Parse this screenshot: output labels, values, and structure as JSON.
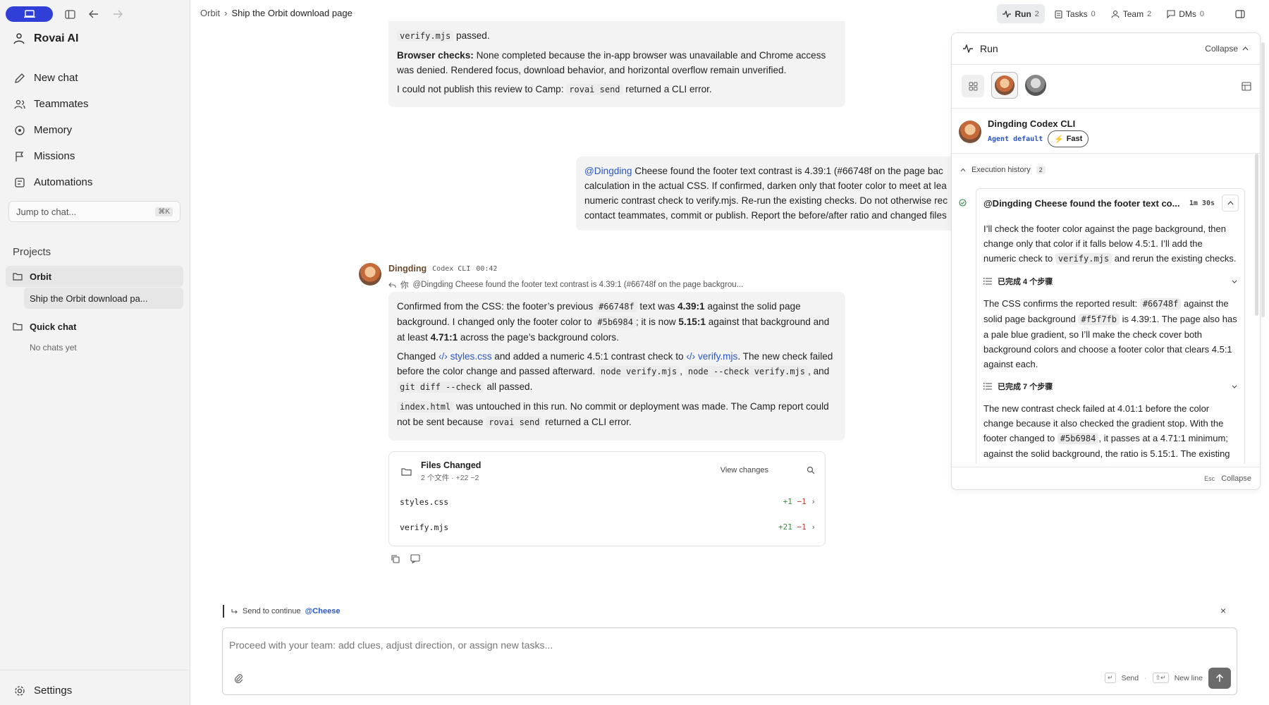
{
  "sidebar": {
    "brand": "Rovai AI",
    "nav": [
      {
        "label": "New chat",
        "icon": "edit-icon"
      },
      {
        "label": "Teammates",
        "icon": "users-icon"
      },
      {
        "label": "Memory",
        "icon": "memory-icon"
      },
      {
        "label": "Missions",
        "icon": "flag-icon"
      },
      {
        "label": "Automations",
        "icon": "automation-icon"
      }
    ],
    "jump": {
      "label": "Jump to chat...",
      "shortcut": "⌘K"
    },
    "projects_heading": "Projects",
    "projects": [
      {
        "name": "Orbit",
        "chat": "Ship the Orbit download pa..."
      },
      {
        "name": "Quick chat",
        "chat": "No chats yet"
      }
    ],
    "settings": "Settings"
  },
  "header": {
    "crumb_project": "Orbit",
    "crumb_sep": "›",
    "crumb_page": "Ship the Orbit download page",
    "buttons": [
      {
        "label": "Run",
        "count": "2"
      },
      {
        "label": "Tasks",
        "count": "0"
      },
      {
        "label": "Team",
        "count": "2"
      },
      {
        "label": "DMs",
        "count": "0"
      }
    ]
  },
  "chat": {
    "top_bubble": {
      "line1_code": "verify.mjs",
      "line1_rest": " passed.",
      "browser_bold": "Browser checks:",
      "browser_text": " None completed because the in-app browser was unavailable and Chrome access was denied. Rendered focus, download behavior, and horizontal overflow remain unverified.",
      "camp_pre": "I could not publish this review to Camp: ",
      "camp_code": "rovai send",
      "camp_post": " returned a CLI error."
    },
    "user_bubble": {
      "mention": "@Dingding",
      "lines": [
        " Cheese found the footer text contrast is 4.39:1 (#66748f on the page bac",
        "calculation in the actual CSS. If confirmed, darken only that footer color to meet at lea",
        "numeric contrast check to verify.mjs. Re-run the existing checks. Do not otherwise rec",
        "contact teammates, commit or publish. Report the before/after ratio and changed files"
      ]
    },
    "reply": {
      "author": "Dingding",
      "tag": "Codex CLI",
      "time": "00:42",
      "quote_you": "你",
      "quote": "@Dingding Cheese found the footer text contrast is 4.39:1 (#66748f on the page backgrou...",
      "p1": [
        "Confirmed from the CSS: the footer’s previous ",
        "#66748f",
        " text was ",
        "4.39:1",
        " against the solid page background. I changed only the footer color to ",
        "#5b6984",
        "; it is now ",
        "5.15:1",
        " against that background and at least ",
        "4.71:1",
        " across the page’s background colors."
      ],
      "p2": [
        "Changed ",
        "styles.css",
        " and added a numeric 4.5:1 contrast check to ",
        "verify.mjs",
        ". The new check failed before the color change and passed afterward. ",
        "node verify.mjs",
        ", ",
        "node --check verify.mjs",
        ", and ",
        "git diff --check",
        " all passed."
      ],
      "p3": [
        "index.html",
        " was untouched in this run. No commit or deployment was made. The Camp report could not be sent because ",
        "rovai send",
        " returned a CLI error."
      ]
    },
    "files": {
      "title": "Files Changed",
      "summary": "2 个文件 · +22 −2",
      "view": "View changes",
      "rows": [
        {
          "name": "styles.css",
          "add": "+1",
          "del": "−1"
        },
        {
          "name": "verify.mjs",
          "add": "+21",
          "del": "−1"
        }
      ]
    }
  },
  "composer": {
    "continue_text": "Send to continue",
    "continue_mention": "@Cheese",
    "placeholder": "Proceed with your team: add clues, adjust direction, or assign new tasks...",
    "send": "Send",
    "newline": "New line"
  },
  "run_panel": {
    "title": "Run",
    "collapse": "Collapse",
    "agent_name": "Dingding Codex CLI",
    "agent_default": "Agent default",
    "fast": "Fast",
    "history_label": "Execution history",
    "history_count": "2",
    "card_title": "@Dingding Cheese found the footer text co...",
    "card_time": "1m 30s",
    "t1": [
      "I’ll check the footer color against the page background, then change only that color if it falls below 4.5:1. I’ll add the numeric check to ",
      "verify.mjs",
      " and rerun the existing checks."
    ],
    "steps1": "已完成 4 个步骤",
    "t2": [
      "The CSS confirms the reported result: ",
      "#66748f",
      " against the solid page background ",
      "#f5f7fb",
      " is 4.39:1. The page also has a pale blue gradient, so I’ll make the check cover both background colors and choose a footer color that clears 4.5:1 against each."
    ],
    "steps2": "已完成 7 个步骤",
    "t3": [
      "The new contrast check failed at 4.01:1 before the color change because it also checked the gradient stop. With the footer changed to ",
      "#5b6984",
      ", it passes at a 4.71:1 minimum; against the solid background, the ratio is 5.15:1. The existing"
    ],
    "foot_key": "Esc",
    "foot_label": "Collapse"
  }
}
